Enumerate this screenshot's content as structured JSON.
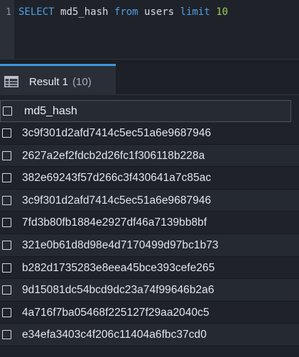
{
  "editor": {
    "line_number": "1",
    "query": {
      "select_kw": "SELECT",
      "column": "md5_hash",
      "from_kw": "from",
      "table": "users",
      "limit_kw": "limit",
      "limit_value": "10"
    }
  },
  "result_tab": {
    "label": "Result 1",
    "count": "(10)",
    "icon": "table-grid-icon"
  },
  "grid": {
    "column_header": "md5_hash",
    "rows": [
      "3c9f301d2afd7414c5ec51a6e9687946",
      "2627a2ef2fdcb2d26fc1f306118b228a",
      "382e69243f57d266c3f430641a7c85ac",
      "3c9f301d2afd7414c5ec51a6e9687946",
      "7fd3b80fb1884e2927df46a7139bb8bf",
      "321e0b61d8d98e4d7170499d97bc1b73",
      "b282d1735283e8eea45bce393cefe265",
      "9d15081dc54bcd9dc23a74f99646b2a6",
      "4a716f7ba05468f225127f29aa2040c5",
      "e34efa3403c4f206c11404a6fbc37cd0"
    ]
  },
  "colors": {
    "keyword": "#4f9fe8",
    "number": "#9fca56",
    "tab_accent": "#3b97e2",
    "background": "#1e2329"
  }
}
